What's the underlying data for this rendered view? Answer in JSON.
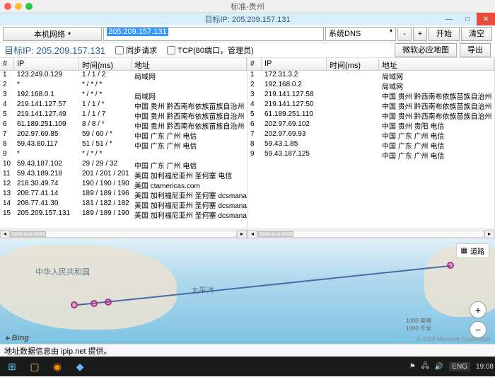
{
  "window": {
    "title": "标准-贵州",
    "subtitle": "目标IP: 205.209.157.131"
  },
  "toolbar": {
    "local_net": "本机网络",
    "ip_value": "205.209.157.131",
    "dns": "系统DNS",
    "start": "开始",
    "clear": "清空"
  },
  "row2": {
    "target_label": "目标IP: 205.209.157.131",
    "sync_req": "同步请求",
    "tcp_label": "TCP(80端口，管理员)",
    "bing_map": "微软必应地图",
    "export": "导出"
  },
  "headers": {
    "num": "#",
    "ip": "IP",
    "time": "时间(ms)",
    "addr": "地址"
  },
  "left_rows": [
    {
      "n": "1",
      "ip": "123.249.0.129",
      "t": "1 / 1 / 2",
      "a": "局域网"
    },
    {
      "n": "2",
      "ip": "*",
      "t": "* / * / *",
      "a": ""
    },
    {
      "n": "3",
      "ip": "192.168.0.1",
      "t": "* / * / *",
      "a": "局域网"
    },
    {
      "n": "4",
      "ip": "219.141.127.57",
      "t": "1 / 1 / *",
      "a": "中国 贵州 黔西南布依族苗族自治州 电信"
    },
    {
      "n": "5",
      "ip": "219.141.127.49",
      "t": "1 / 1 / 7",
      "a": "中国 贵州 黔西南布依族苗族自治州 电信"
    },
    {
      "n": "6",
      "ip": "61.189.251.109",
      "t": "8 / 8 / *",
      "a": "中国 贵州 黔西南布依族苗族自治州 电信"
    },
    {
      "n": "7",
      "ip": "202.97.69.85",
      "t": "59 / 60 / *",
      "a": "中国 广东 广州 电信"
    },
    {
      "n": "8",
      "ip": "59.43.80.117",
      "t": "51 / 51 / *",
      "a": "中国 广东 广州 电信"
    },
    {
      "n": "9",
      "ip": "*",
      "t": "* / * / *",
      "a": ""
    },
    {
      "n": "10",
      "ip": "59.43.187.102",
      "t": "29 / 29 / 32",
      "a": "中国 广东 广州 电信"
    },
    {
      "n": "11",
      "ip": "59.43.189.218",
      "t": "201 / 201 / 201",
      "a": "美国 加利福尼亚州 圣何塞 电信"
    },
    {
      "n": "12",
      "ip": "218.30.49.74",
      "t": "190 / 190 / 190",
      "a": "美国 ctamericas.com"
    },
    {
      "n": "13",
      "ip": "208.77.41.14",
      "t": "189 / 189 / 196",
      "a": "美国 加利福尼亚州 圣何塞 dcsmanage.com"
    },
    {
      "n": "14",
      "ip": "208.77.41.30",
      "t": "181 / 182 / 182",
      "a": "美国 加利福尼亚州 圣何塞 dcsmanage.com"
    },
    {
      "n": "15",
      "ip": "205.209.157.131",
      "t": "189 / 189 / 190",
      "a": "美国 加利福尼亚州 圣何塞 dcsmanage.com"
    }
  ],
  "right_rows": [
    {
      "n": "1",
      "ip": "172.31.3.2",
      "t": "",
      "a": "局域网"
    },
    {
      "n": "2",
      "ip": "192.168.0.2",
      "t": "",
      "a": "局域网"
    },
    {
      "n": "3",
      "ip": "219.141.127.58",
      "t": "",
      "a": "中国 贵州 黔西南布依族苗族自治州 电信"
    },
    {
      "n": "4",
      "ip": "219.141.127.50",
      "t": "",
      "a": "中国 贵州 黔西南布依族苗族自治州 电信"
    },
    {
      "n": "5",
      "ip": "61.189.251.110",
      "t": "",
      "a": "中国 贵州 黔西南布依族苗族自治州 电信"
    },
    {
      "n": "6",
      "ip": "202.97.69.102",
      "t": "",
      "a": "中国 贵州 贵阳 电信"
    },
    {
      "n": "7",
      "ip": "202.97.69.93",
      "t": "",
      "a": "中国 广东 广州 电信"
    },
    {
      "n": "8",
      "ip": "59.43.1.85",
      "t": "",
      "a": "中国 广东 广州 电信"
    },
    {
      "n": "9",
      "ip": "59.43.187.125",
      "t": "",
      "a": "中国 广东 广州 电信"
    }
  ],
  "map": {
    "country": "中华人民共和国",
    "ocean": "太平洋",
    "road": "道路",
    "bing": "Bing",
    "scale1": "1000 美哩",
    "scale2": "1000 千米",
    "copyright": "© 2018 Microsoft Corporation"
  },
  "statusbar": {
    "text": "地址数据信息由 ipip.net 提供。"
  },
  "taskbar": {
    "lang": "ENG",
    "time": "19:08"
  }
}
